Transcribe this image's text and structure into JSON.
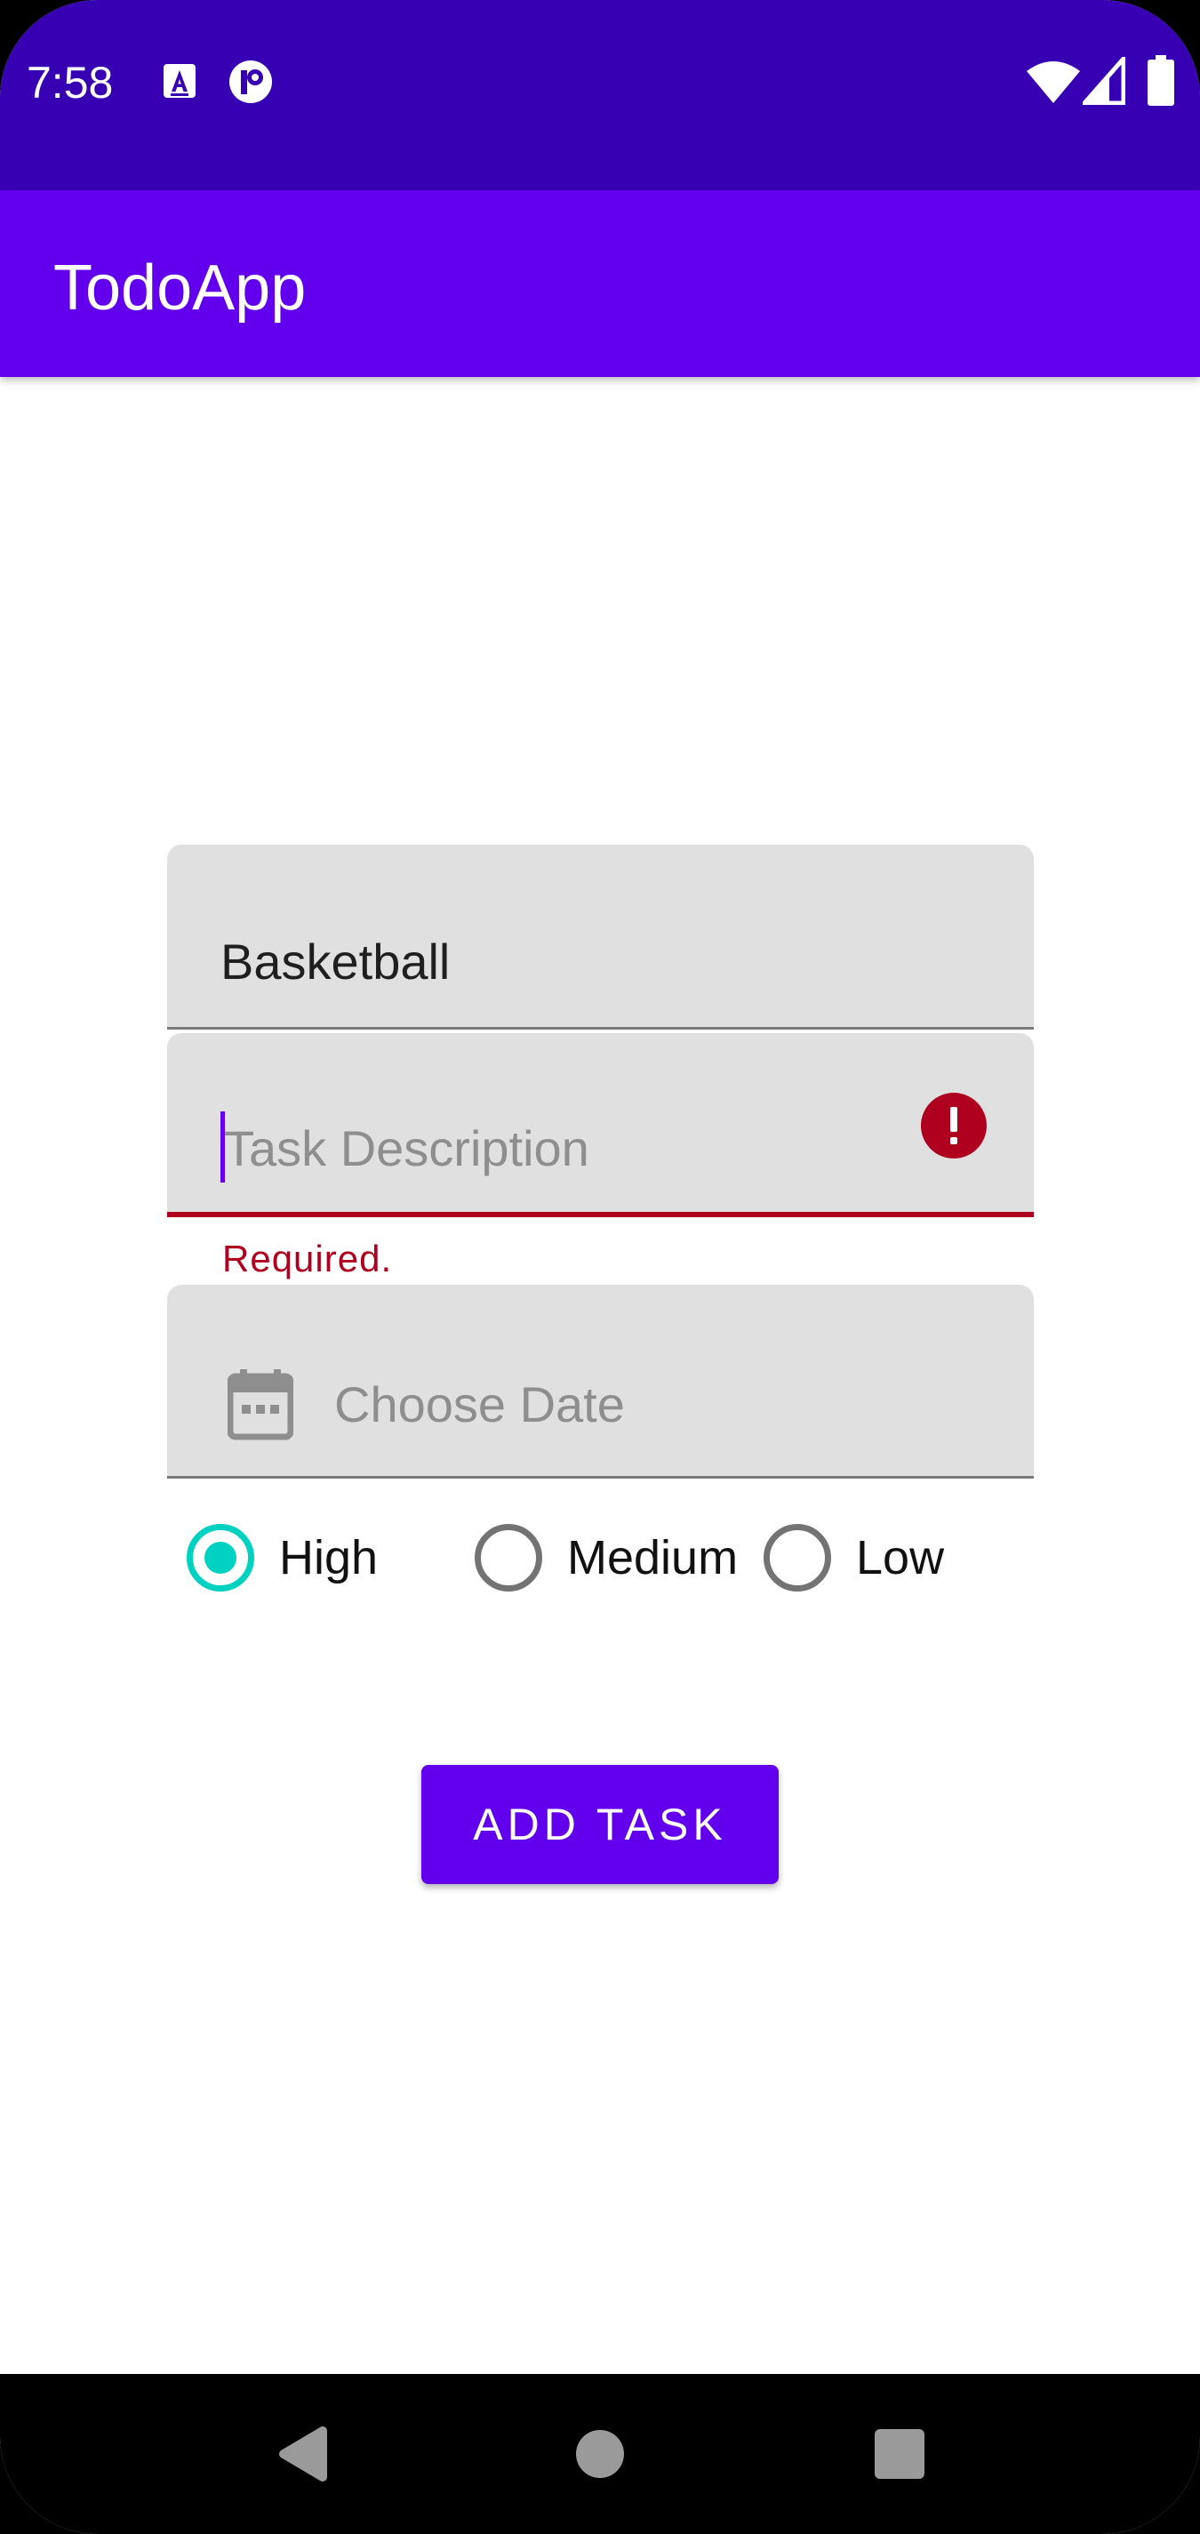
{
  "status_bar": {
    "time": "7:58",
    "left_icons": [
      "a-notification-icon",
      "circle-p-notification-icon"
    ],
    "right_icons": [
      "wifi-icon",
      "cell-signal-icon",
      "battery-icon"
    ]
  },
  "app_bar": {
    "title": "TodoApp"
  },
  "form": {
    "title_field": {
      "value": "Basketball"
    },
    "description_field": {
      "placeholder": "Task Description",
      "error": "Required."
    },
    "date_field": {
      "placeholder": "Choose Date",
      "icon": "calendar-icon"
    },
    "priority": {
      "options": [
        {
          "label": "High",
          "checked": true
        },
        {
          "label": "Medium",
          "checked": false
        },
        {
          "label": "Low",
          "checked": false
        }
      ]
    },
    "submit_label": "ADD TASK"
  },
  "colors": {
    "status_bar": "#3700b3",
    "primary": "#6200ee",
    "accent": "#00d1c1",
    "error": "#b00020"
  },
  "nav_bar": {
    "buttons": [
      "back-icon",
      "home-icon",
      "recents-icon"
    ]
  }
}
